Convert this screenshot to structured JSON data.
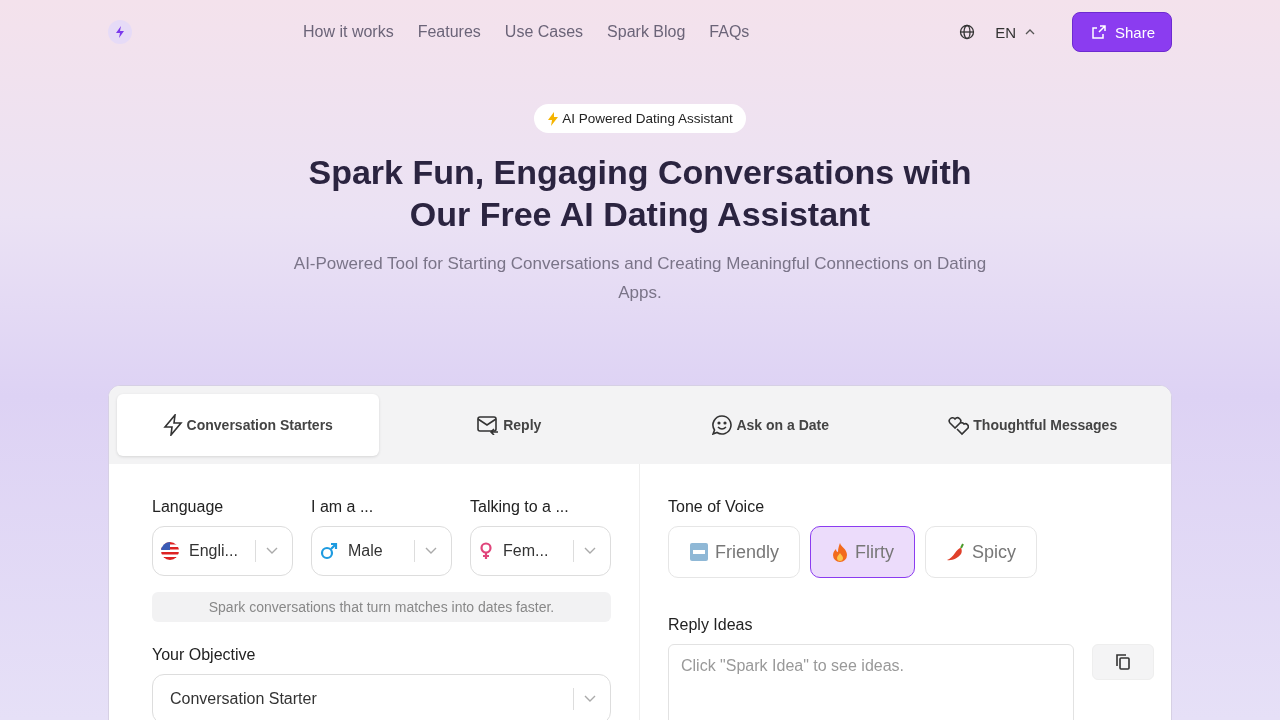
{
  "nav": {
    "links": [
      "How it works",
      "Features",
      "Use Cases",
      "Spark Blog",
      "FAQs"
    ],
    "language": "EN",
    "share": "Share"
  },
  "hero": {
    "badge": "AI Powered Dating Assistant",
    "title_lines": [
      "Spark Fun, Engaging Conversations with",
      "Our Free AI Dating Assistant"
    ],
    "subtitle": "AI-Powered Tool for Starting Conversations and Creating Meaningful Connections on Dating Apps."
  },
  "tabs": [
    {
      "label": "Conversation Starters",
      "selected": true
    },
    {
      "label": "Reply",
      "selected": false
    },
    {
      "label": "Ask on a Date",
      "selected": false
    },
    {
      "label": "Thoughtful Messages",
      "selected": false
    }
  ],
  "form": {
    "selects": [
      {
        "label": "Language",
        "value": "Engli..."
      },
      {
        "label": "I am a ...",
        "value": "Male"
      },
      {
        "label": "Talking to a ...",
        "value": "Fem..."
      }
    ],
    "hint": "Spark conversations that turn matches into dates faster.",
    "objective": {
      "label": "Your Objective",
      "value": "Conversation Starter"
    }
  },
  "tone": {
    "label": "Tone of Voice",
    "options": [
      {
        "label": "Friendly",
        "selected": false
      },
      {
        "label": "Flirty",
        "selected": true
      },
      {
        "label": "Spicy",
        "selected": false
      }
    ]
  },
  "reply_ideas": {
    "label": "Reply Ideas",
    "placeholder": "Click \"Spark Idea\" to see ideas."
  }
}
